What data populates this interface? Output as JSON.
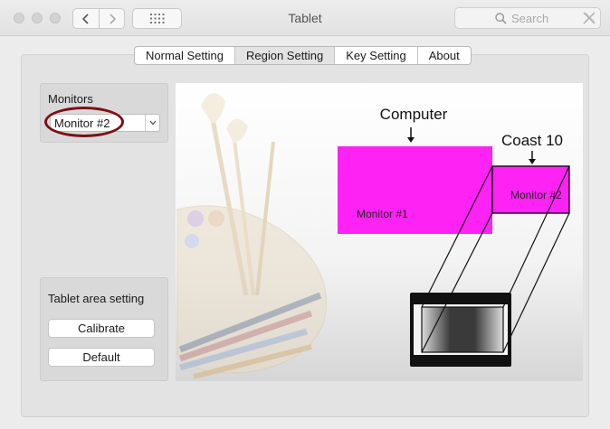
{
  "window": {
    "title": "Tablet"
  },
  "search": {
    "placeholder": "Search"
  },
  "tabs": [
    {
      "label": "Normal Setting"
    },
    {
      "label": "Region Setting"
    },
    {
      "label": "Key Setting"
    },
    {
      "label": "About"
    }
  ],
  "active_tab": "Region Setting",
  "monitors": {
    "label": "Monitors",
    "selected": "Monitor #2"
  },
  "tablet_area": {
    "label": "Tablet area setting",
    "calibrate_label": "Calibrate",
    "default_label": "Default"
  },
  "diagram": {
    "computer_label": "Computer",
    "device_label": "Coast 10",
    "monitor1_label": "Monitor #1",
    "monitor2_label": "Monitor #2",
    "monitor_color": "#ff22f4"
  },
  "icons": [
    "back-icon",
    "forward-icon",
    "grid-icon",
    "search-icon",
    "clear-icon",
    "chevron-down-icon"
  ]
}
